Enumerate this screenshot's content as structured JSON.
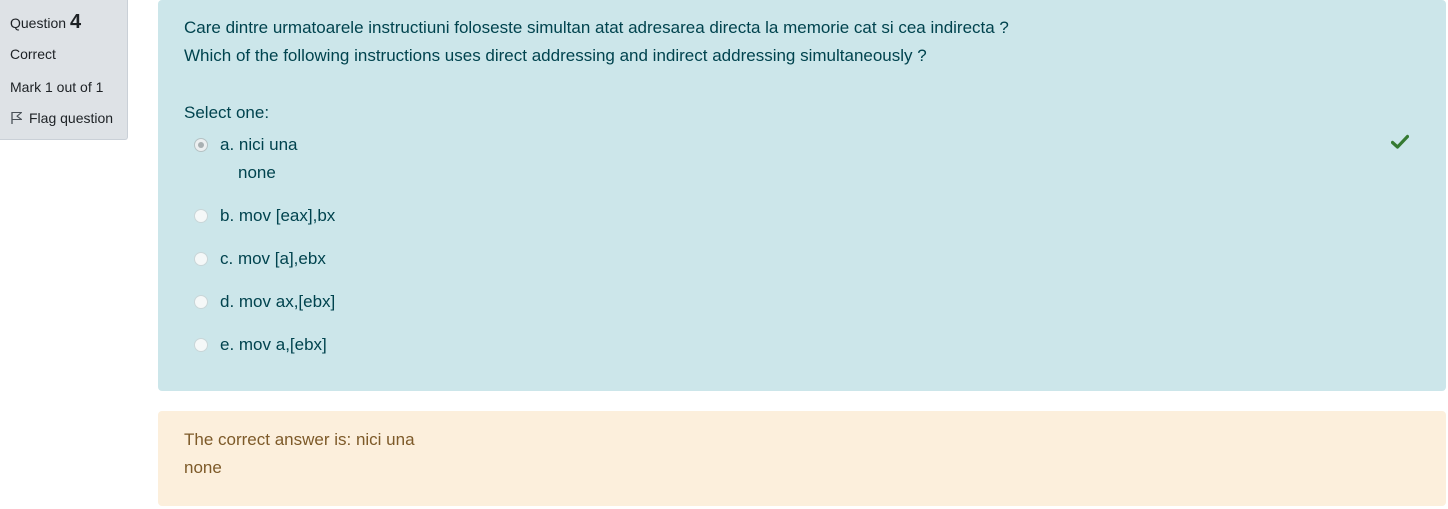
{
  "info": {
    "question_label": "Question",
    "question_number": "4",
    "state": "Correct",
    "grade": "Mark 1 out of 1",
    "flag_label": "Flag question"
  },
  "question": {
    "text_ro": "Care dintre urmatoarele instructiuni foloseste simultan atat adresarea directa la memorie cat si cea indirecta ?",
    "text_en": "Which of the following instructions uses direct addressing and indirect addressing simultaneously ?",
    "prompt": "Select one:",
    "options": [
      {
        "label": "a. nici una",
        "label2": "none",
        "selected": true,
        "correct": true
      },
      {
        "label": "b. mov [eax],bx",
        "selected": false
      },
      {
        "label": "c. mov [a],ebx",
        "selected": false
      },
      {
        "label": "d. mov ax,[ebx]",
        "selected": false
      },
      {
        "label": "e. mov a,[ebx]",
        "selected": false
      }
    ]
  },
  "feedback": {
    "line1": "The correct answer is: nici una",
    "line2": "none"
  },
  "colors": {
    "formulation_bg": "#cce6ea",
    "formulation_text": "#00434e",
    "feedback_bg": "#fcefdc",
    "feedback_text": "#7d5a29",
    "info_bg": "#dee2e6",
    "correct_icon": "#357a32"
  },
  "icons": {
    "flag": "flag-outline-icon",
    "correct": "check-icon"
  }
}
